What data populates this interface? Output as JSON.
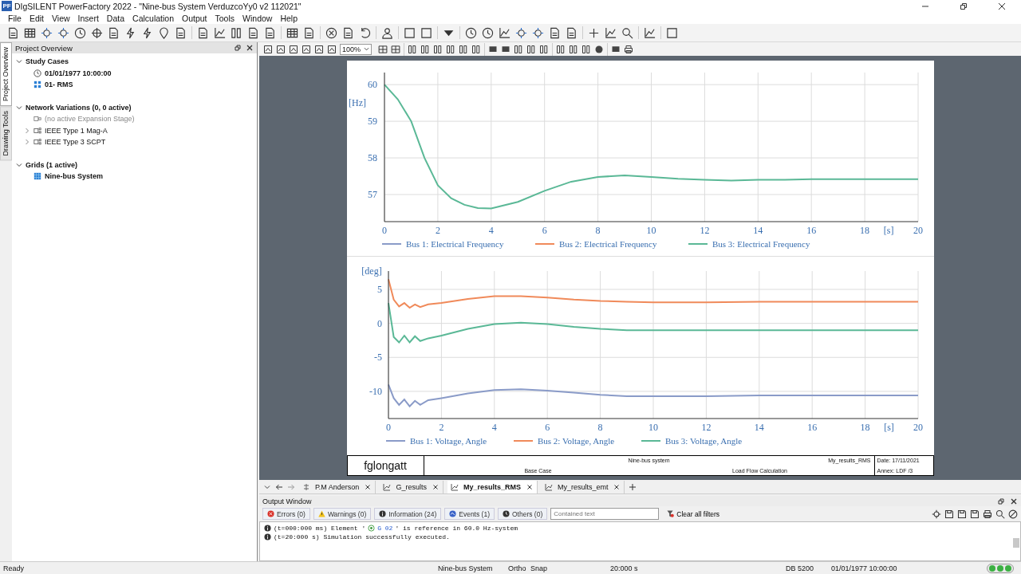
{
  "window": {
    "app_logo": "PF",
    "title": "DIgSILENT PowerFactory 2022  -  \"Nine-bus System VerduzcoYy0 v2 112021\""
  },
  "menu": [
    "File",
    "Edit",
    "View",
    "Insert",
    "Data",
    "Calculation",
    "Output",
    "Tools",
    "Window",
    "Help"
  ],
  "side_tabs": [
    {
      "label": "Project Overview",
      "selected": true
    },
    {
      "label": "Drawing Tools",
      "selected": false
    }
  ],
  "project_overview": {
    "title": "Project Overview",
    "sections": [
      {
        "label": "Study Cases",
        "expanded": true,
        "children": [
          {
            "label": "01/01/1977 10:00:00",
            "kind": "time",
            "active": true
          },
          {
            "label": "01- RMS",
            "kind": "case",
            "active": true
          }
        ]
      },
      {
        "label": "Network Variations (0, 0 active)",
        "expanded": true,
        "children": [
          {
            "label": "(no active Expansion Stage)",
            "kind": "stage",
            "active": false,
            "disabled": true
          },
          {
            "label": "IEEE Type 1 Mag-A",
            "kind": "variation",
            "active": false,
            "expanded": false
          },
          {
            "label": "IEEE Type 3 SCPT",
            "kind": "variation",
            "active": false,
            "expanded": false
          }
        ]
      },
      {
        "label": "Grids (1 active)",
        "expanded": true,
        "children": [
          {
            "label": "Nine-bus System",
            "kind": "grid",
            "active": true
          }
        ]
      }
    ]
  },
  "graphic_toolbar": {
    "zoom": "100%"
  },
  "plot_page": {
    "charts": [
      {
        "chart_data": {
          "type": "line",
          "xlabel": "[s]",
          "ylabel": "[Hz]",
          "grid": true,
          "legend": true,
          "x": [
            0,
            0.5,
            1,
            1.5,
            2,
            2.5,
            3,
            3.5,
            4,
            5,
            6,
            7,
            8,
            9,
            10,
            11,
            12,
            13,
            14,
            15,
            16,
            17,
            18,
            19,
            20
          ],
          "xlim": [
            0,
            20
          ],
          "ylim": [
            56.26,
            60.33
          ],
          "xticks": [
            0,
            2,
            4,
            6,
            8,
            10,
            12,
            14,
            16,
            18,
            20
          ],
          "yticks": [
            57,
            58,
            59,
            60
          ],
          "series": [
            {
              "name": "Bus 1: Electrical Frequency",
              "color": "#8a9bc8",
              "values": [
                null,
                null,
                null,
                null,
                null,
                null,
                null,
                null,
                null,
                null,
                null,
                null,
                null,
                null,
                null,
                null,
                null,
                null,
                null,
                null,
                null,
                null,
                null,
                null,
                null
              ]
            },
            {
              "name": "Bus 2: Electrical Frequency",
              "color": "#f08a5a",
              "values": [
                null,
                null,
                null,
                null,
                null,
                null,
                null,
                null,
                null,
                null,
                null,
                null,
                null,
                null,
                null,
                null,
                null,
                null,
                null,
                null,
                null,
                null,
                null,
                null,
                null
              ]
            },
            {
              "name": "Bus 3: Electrical Frequency",
              "color": "#5ab896",
              "values": [
                60,
                59.6,
                59.0,
                58.0,
                57.25,
                56.9,
                56.72,
                56.63,
                56.62,
                56.8,
                57.1,
                57.35,
                57.48,
                57.52,
                57.48,
                57.43,
                57.4,
                57.38,
                57.4,
                57.4,
                57.42,
                57.42,
                57.42,
                57.42,
                57.42
              ]
            }
          ]
        }
      },
      {
        "chart_data": {
          "type": "line",
          "xlabel": "[s]",
          "ylabel": "[deg]",
          "grid": true,
          "legend": true,
          "x": [
            0,
            0.2,
            0.4,
            0.6,
            0.8,
            1,
            1.2,
            1.5,
            2,
            3,
            4,
            5,
            6,
            7,
            8,
            9,
            10,
            12,
            14,
            16,
            18,
            20
          ],
          "xlim": [
            0,
            20
          ],
          "ylim": [
            -14,
            7.7
          ],
          "xticks": [
            0,
            2,
            4,
            6,
            8,
            10,
            12,
            14,
            16,
            18,
            20
          ],
          "yticks": [
            -10,
            -5,
            0,
            5
          ],
          "series": [
            {
              "name": "Bus 1: Voltage, Angle",
              "color": "#8a9bc8",
              "values": [
                -9,
                -11,
                -12,
                -11.2,
                -12.2,
                -11.4,
                -12,
                -11.3,
                -11,
                -10.3,
                -9.8,
                -9.7,
                -9.9,
                -10.2,
                -10.5,
                -10.7,
                -10.7,
                -10.7,
                -10.6,
                -10.6,
                -10.6,
                -10.6
              ]
            },
            {
              "name": "Bus 2: Voltage, Angle",
              "color": "#f08a5a",
              "values": [
                6.5,
                3.5,
                2.5,
                3.0,
                2.3,
                2.8,
                2.4,
                2.8,
                3.0,
                3.6,
                4.0,
                4.0,
                3.8,
                3.5,
                3.3,
                3.2,
                3.1,
                3.1,
                3.2,
                3.2,
                3.2,
                3.2
              ]
            },
            {
              "name": "Bus 3: Voltage, Angle",
              "color": "#5ab896",
              "values": [
                3,
                -2,
                -2.8,
                -1.8,
                -2.8,
                -1.9,
                -2.6,
                -2.2,
                -1.8,
                -0.8,
                -0.1,
                0.1,
                -0.1,
                -0.5,
                -0.8,
                -1.0,
                -1.0,
                -1.0,
                -1.0,
                -1.0,
                -1.0,
                -1.0
              ]
            }
          ]
        }
      }
    ],
    "title_block": {
      "author": "fglongatt",
      "project": "Nine-bus system",
      "plot_name": "My_results_RMS",
      "study_case": "Base Case",
      "calculation": "Load Flow Calculation",
      "date": "Date: 17/11/2021",
      "annex": "Annex: LDF /3"
    }
  },
  "document_tabs": [
    {
      "label": "P.M Anderson",
      "kind": "network",
      "selected": false
    },
    {
      "label": "G_results",
      "kind": "plot",
      "selected": false
    },
    {
      "label": "My_results_RMS",
      "kind": "plot",
      "selected": true
    },
    {
      "label": "My_results_emt",
      "kind": "plot",
      "selected": false
    }
  ],
  "output_window": {
    "title": "Output Window",
    "filters": [
      {
        "label": "Errors (0)",
        "kind": "error"
      },
      {
        "label": "Warnings (0)",
        "kind": "warning"
      },
      {
        "label": "Information (24)",
        "kind": "info"
      },
      {
        "label": "Events (1)",
        "kind": "event"
      },
      {
        "label": "Others (0)",
        "kind": "other"
      }
    ],
    "search": {
      "placeholder": "Contained text"
    },
    "clear_filters": "Clear all filters",
    "messages": [
      {
        "prefix": "(t=000:000 ms) Element '",
        "element": "G 02",
        "suffix": "' is reference in 60.0 Hz-system"
      },
      {
        "text": "(t=20:000 s) Simulation successfully executed."
      }
    ]
  },
  "status_bar": {
    "message": "Ready",
    "items": [
      "Nine-bus System",
      "Ortho",
      "Snap",
      "20:000 s",
      "DB 5200",
      "01/01/1977 10:00:00"
    ]
  }
}
